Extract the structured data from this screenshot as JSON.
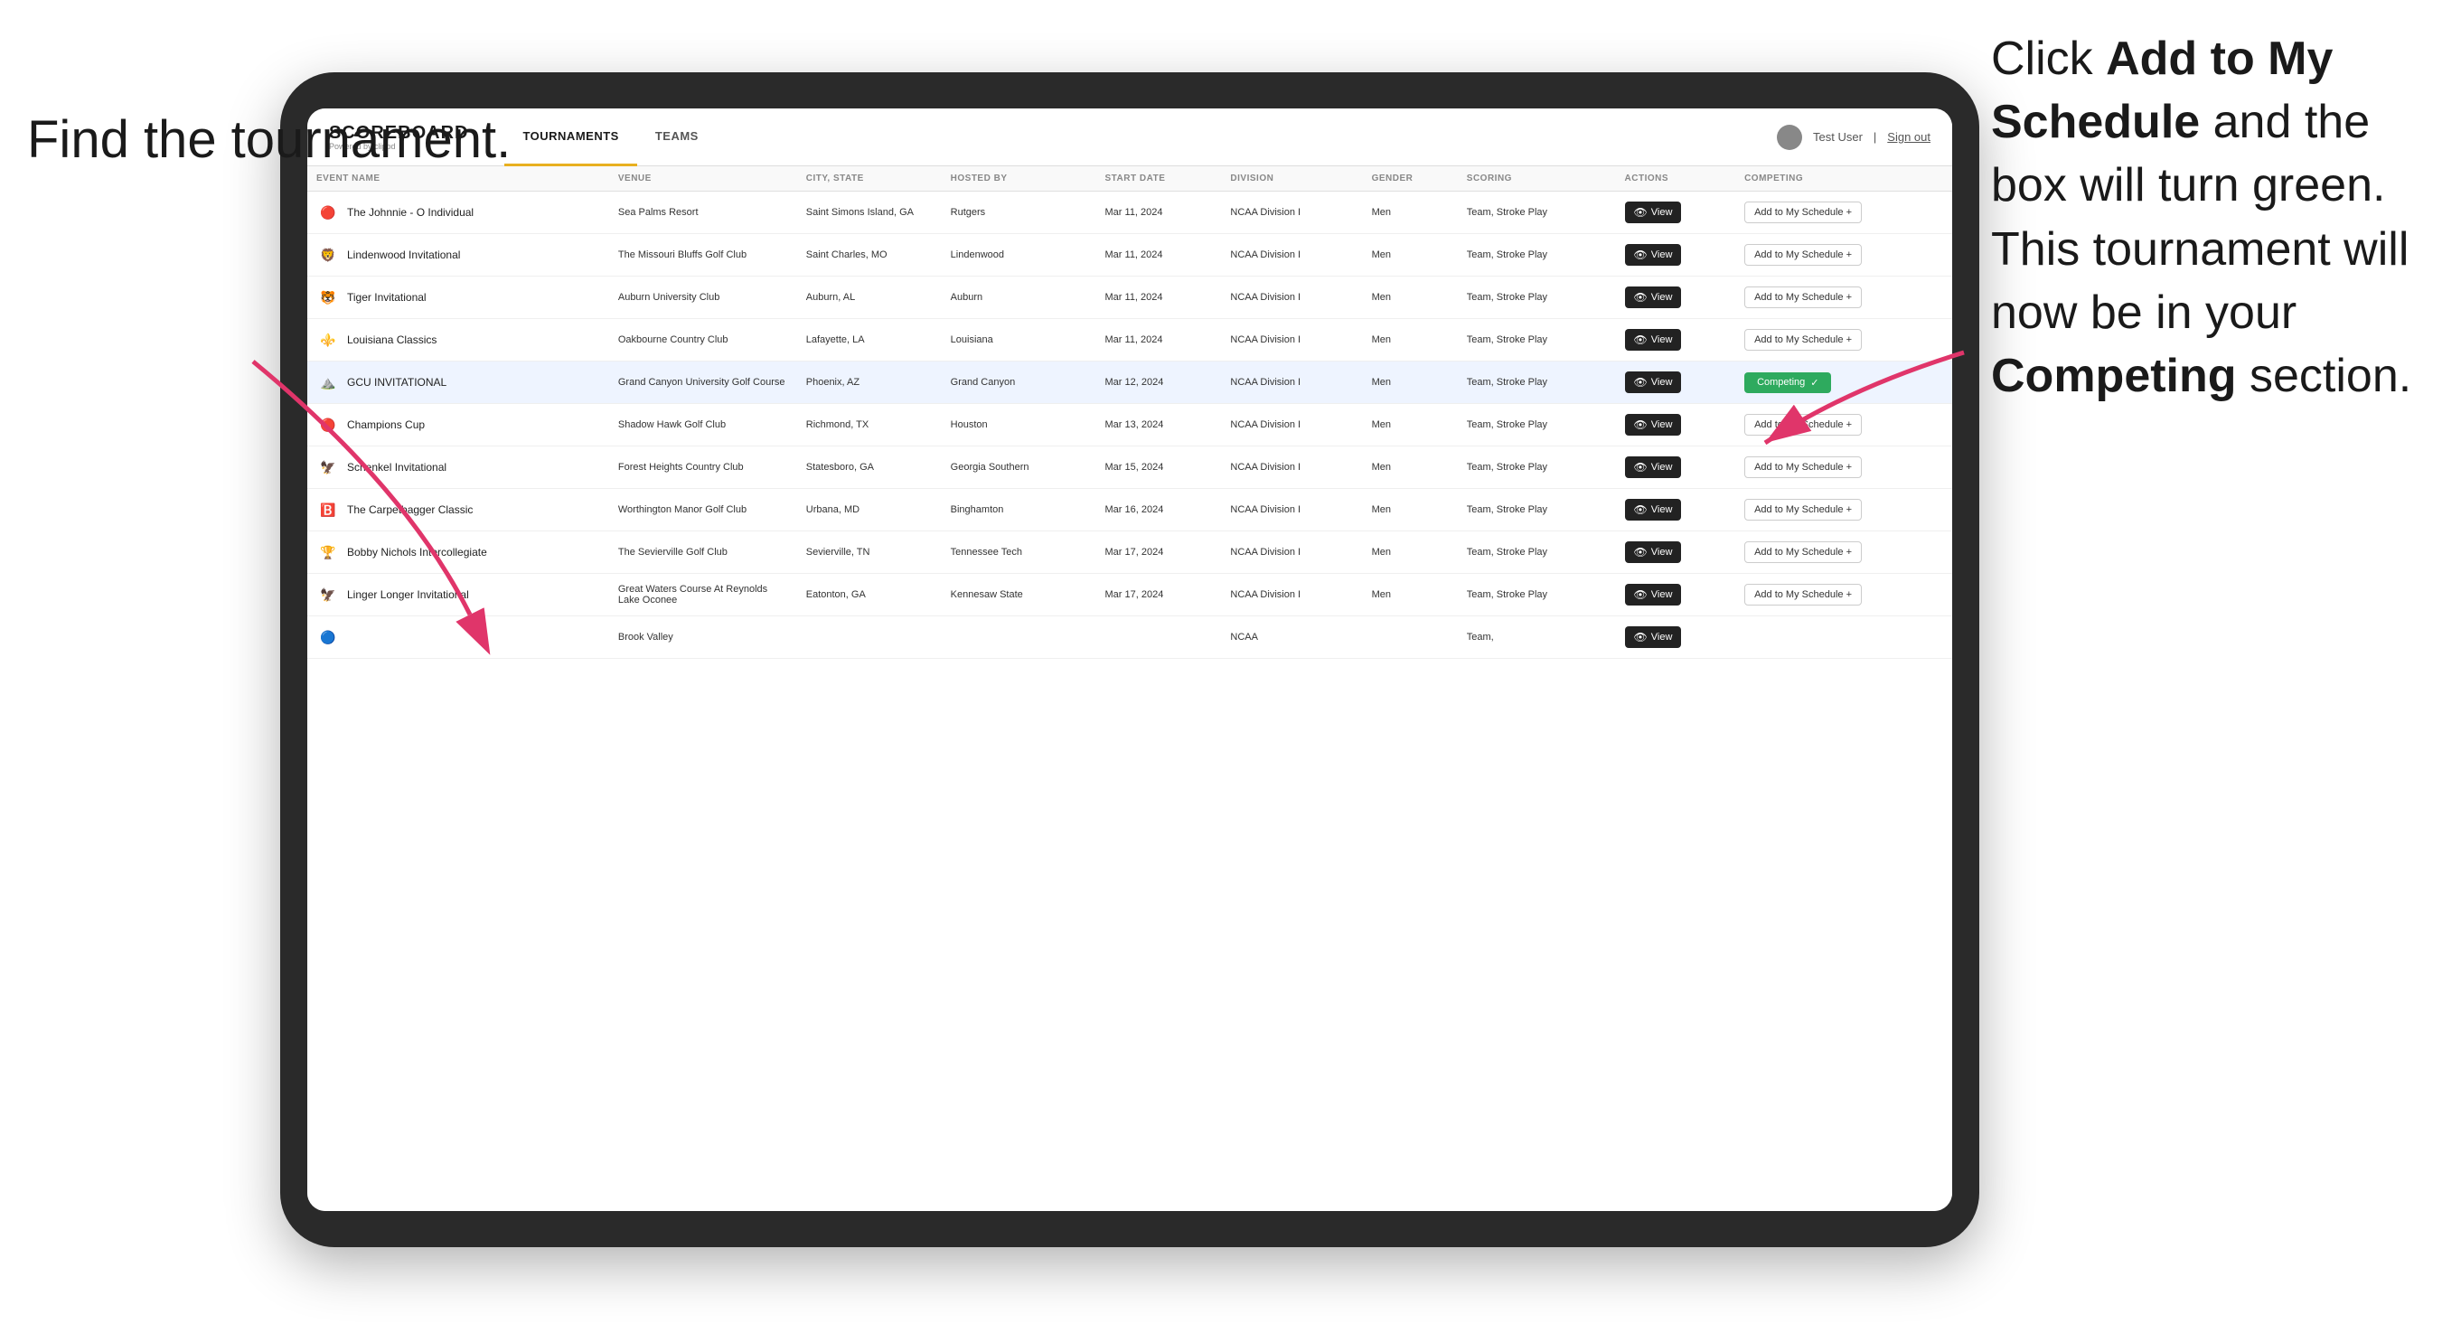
{
  "annotations": {
    "left_title": "Find the tournament.",
    "right_text_line1": "Click ",
    "right_bold1": "Add to My Schedule",
    "right_text_line2": " and the box will turn green. This tournament will now be in your ",
    "right_bold2": "Competing",
    "right_text_line3": " section.",
    "right_full": "Click Add to My Schedule and the box will turn green. This tournament will now be in your Competing section."
  },
  "header": {
    "logo": "SCOREBOARD",
    "logo_sub": "Powered by clippd",
    "tabs": [
      {
        "label": "TOURNAMENTS",
        "active": true
      },
      {
        "label": "TEAMS",
        "active": false
      }
    ],
    "user_label": "Test User",
    "signout_label": "Sign out"
  },
  "table": {
    "columns": [
      "EVENT NAME",
      "VENUE",
      "CITY, STATE",
      "HOSTED BY",
      "START DATE",
      "DIVISION",
      "GENDER",
      "SCORING",
      "ACTIONS",
      "COMPETING"
    ],
    "rows": [
      {
        "logo": "🔴",
        "name": "The Johnnie - O Individual",
        "venue": "Sea Palms Resort",
        "city": "Saint Simons Island, GA",
        "hosted": "Rutgers",
        "date": "Mar 11, 2024",
        "division": "NCAA Division I",
        "gender": "Men",
        "scoring": "Team, Stroke Play",
        "action": "View",
        "competing": "Add to My Schedule +",
        "highlighted": false,
        "competing_status": "add"
      },
      {
        "logo": "🦁",
        "name": "Lindenwood Invitational",
        "venue": "The Missouri Bluffs Golf Club",
        "city": "Saint Charles, MO",
        "hosted": "Lindenwood",
        "date": "Mar 11, 2024",
        "division": "NCAA Division I",
        "gender": "Men",
        "scoring": "Team, Stroke Play",
        "action": "View",
        "competing": "Add to My Schedule +",
        "highlighted": false,
        "competing_status": "add"
      },
      {
        "logo": "🐯",
        "name": "Tiger Invitational",
        "venue": "Auburn University Club",
        "city": "Auburn, AL",
        "hosted": "Auburn",
        "date": "Mar 11, 2024",
        "division": "NCAA Division I",
        "gender": "Men",
        "scoring": "Team, Stroke Play",
        "action": "View",
        "competing": "Add to My Schedule +",
        "highlighted": false,
        "competing_status": "add"
      },
      {
        "logo": "⚜️",
        "name": "Louisiana Classics",
        "venue": "Oakbourne Country Club",
        "city": "Lafayette, LA",
        "hosted": "Louisiana",
        "date": "Mar 11, 2024",
        "division": "NCAA Division I",
        "gender": "Men",
        "scoring": "Team, Stroke Play",
        "action": "View",
        "competing": "Add to My Schedule +",
        "highlighted": false,
        "competing_status": "add"
      },
      {
        "logo": "⛰️",
        "name": "GCU INVITATIONAL",
        "venue": "Grand Canyon University Golf Course",
        "city": "Phoenix, AZ",
        "hosted": "Grand Canyon",
        "date": "Mar 12, 2024",
        "division": "NCAA Division I",
        "gender": "Men",
        "scoring": "Team, Stroke Play",
        "action": "View",
        "competing": "Competing",
        "highlighted": true,
        "competing_status": "competing"
      },
      {
        "logo": "🔴",
        "name": "Champions Cup",
        "venue": "Shadow Hawk Golf Club",
        "city": "Richmond, TX",
        "hosted": "Houston",
        "date": "Mar 13, 2024",
        "division": "NCAA Division I",
        "gender": "Men",
        "scoring": "Team, Stroke Play",
        "action": "View",
        "competing": "Add to My Schedule +",
        "highlighted": false,
        "competing_status": "add"
      },
      {
        "logo": "🦅",
        "name": "Schenkel Invitational",
        "venue": "Forest Heights Country Club",
        "city": "Statesboro, GA",
        "hosted": "Georgia Southern",
        "date": "Mar 15, 2024",
        "division": "NCAA Division I",
        "gender": "Men",
        "scoring": "Team, Stroke Play",
        "action": "View",
        "competing": "Add to My Schedule +",
        "highlighted": false,
        "competing_status": "add"
      },
      {
        "logo": "🅱️",
        "name": "The Carpetbagger Classic",
        "venue": "Worthington Manor Golf Club",
        "city": "Urbana, MD",
        "hosted": "Binghamton",
        "date": "Mar 16, 2024",
        "division": "NCAA Division I",
        "gender": "Men",
        "scoring": "Team, Stroke Play",
        "action": "View",
        "competing": "Add to My Schedule +",
        "highlighted": false,
        "competing_status": "add"
      },
      {
        "logo": "🏆",
        "name": "Bobby Nichols Intercollegiate",
        "venue": "The Sevierville Golf Club",
        "city": "Sevierville, TN",
        "hosted": "Tennessee Tech",
        "date": "Mar 17, 2024",
        "division": "NCAA Division I",
        "gender": "Men",
        "scoring": "Team, Stroke Play",
        "action": "View",
        "competing": "Add to My Schedule +",
        "highlighted": false,
        "competing_status": "add"
      },
      {
        "logo": "🦅",
        "name": "Linger Longer Invitational",
        "venue": "Great Waters Course At Reynolds Lake Oconee",
        "city": "Eatonton, GA",
        "hosted": "Kennesaw State",
        "date": "Mar 17, 2024",
        "division": "NCAA Division I",
        "gender": "Men",
        "scoring": "Team, Stroke Play",
        "action": "View",
        "competing": "Add to My Schedule +",
        "highlighted": false,
        "competing_status": "add"
      },
      {
        "logo": "🔵",
        "name": "",
        "venue": "Brook Valley",
        "city": "",
        "hosted": "",
        "date": "",
        "division": "NCAA",
        "gender": "",
        "scoring": "Team,",
        "action": "View",
        "competing": "",
        "highlighted": false,
        "competing_status": "add"
      }
    ]
  },
  "colors": {
    "competing_green": "#2eaa5e",
    "accent_yellow": "#e8b020",
    "arrow_pink": "#e0356a",
    "header_bg": "#ffffff",
    "row_highlight": "#eef4ff"
  }
}
